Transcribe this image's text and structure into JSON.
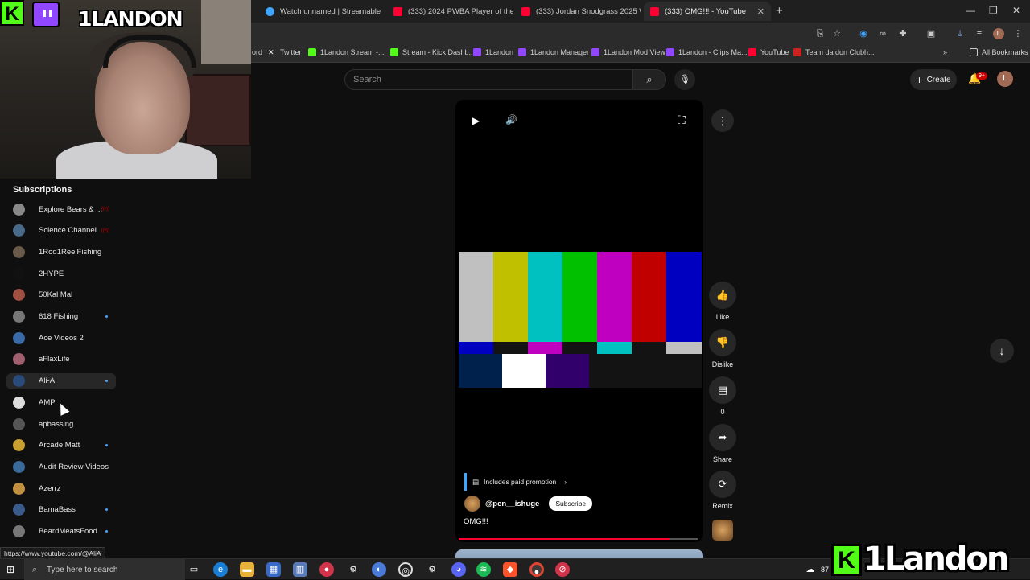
{
  "tabs": [
    {
      "title": "Watch unnamed | Streamable",
      "color": "#3ea6ff"
    },
    {
      "title": "(333) 2024 PWBA Player of the",
      "color": "#ff0033"
    },
    {
      "title": "(333) Jordan Snodgrass 2025 W",
      "color": "#ff0033"
    },
    {
      "title": "(333) OMG!!! - YouTube",
      "color": "#ff0033",
      "active": true
    }
  ],
  "bookmarks": [
    {
      "label": "ord",
      "color": "#5865f2"
    },
    {
      "label": "Twitter",
      "color": "#000000"
    },
    {
      "label": "1Landon Stream -...",
      "color": "#53fc18"
    },
    {
      "label": "Stream - Kick Dashb...",
      "color": "#53fc18"
    },
    {
      "label": "1Landon",
      "color": "#9146ff"
    },
    {
      "label": "1Landon Manager",
      "color": "#9146ff"
    },
    {
      "label": "1Landon Mod View",
      "color": "#9146ff"
    },
    {
      "label": "1Landon - Clips Ma...",
      "color": "#9146ff"
    },
    {
      "label": "YouTube",
      "color": "#ff0033"
    },
    {
      "label": "Team da don Clubh...",
      "color": "#cc2222"
    }
  ],
  "all_bookmarks": "All Bookmarks",
  "webcam_brand": "1LANDON",
  "search_placeholder": "Search",
  "create_label": "Create",
  "notif_badge": "9+",
  "avatar_letter": "L",
  "subs_title": "Subscriptions",
  "subscriptions": [
    {
      "name": "Explore Bears & ...",
      "color": "#888888",
      "live": true
    },
    {
      "name": "Science Channel",
      "color": "#4a6a8a",
      "live": true
    },
    {
      "name": "1Rod1ReelFishing",
      "color": "#6a5a4a"
    },
    {
      "name": "2HYPE",
      "color": "#111111"
    },
    {
      "name": "50Kal Mal",
      "color": "#a05040"
    },
    {
      "name": "618 Fishing",
      "color": "#777777",
      "dot": true
    },
    {
      "name": "Ace Videos 2",
      "color": "#3a6aa8"
    },
    {
      "name": "aFlaxLife",
      "color": "#a06070"
    },
    {
      "name": "Ali-A",
      "color": "#2a4a7a",
      "dot": true,
      "highlight": true
    },
    {
      "name": "AMP",
      "color": "#dddddd"
    },
    {
      "name": "apbassing",
      "color": "#555555"
    },
    {
      "name": "Arcade Matt",
      "color": "#c8a030",
      "dot": true
    },
    {
      "name": "Audit Review Videos",
      "color": "#3a6a9a"
    },
    {
      "name": "Azerrz",
      "color": "#c09040"
    },
    {
      "name": "BamaBass",
      "color": "#3a5a8a",
      "dot": true
    },
    {
      "name": "BeardMeatsFood",
      "color": "#777777",
      "dot": true
    }
  ],
  "status_url": "https://www.youtube.com/@AliA",
  "player": {
    "color_bars_top": [
      "#c0c0c0",
      "#c0c000",
      "#00c0c0",
      "#00c000",
      "#c000c0",
      "#c00000",
      "#0000c0"
    ],
    "color_bars_mid": [
      "#0000c0",
      "#131313",
      "#c000c0",
      "#131313",
      "#00c0c0",
      "#131313",
      "#c0c0c0"
    ],
    "color_bars_low": [
      "#00214c",
      "#ffffff",
      "#32006a",
      "#131313",
      "#131313",
      "#131313",
      "#131313"
    ],
    "progress": 0.88
  },
  "promo_label": "Includes paid promotion",
  "channel_handle": "@pen__ishuge",
  "subscribe_label": "Subscribe",
  "video_title": "OMG!!!",
  "actions": {
    "like": "Like",
    "dislike": "Dislike",
    "comments": "0",
    "share": "Share",
    "remix": "Remix"
  },
  "taskbar_search": "Type here to search",
  "overlay_brand": "1Landon",
  "tray_text": "87"
}
